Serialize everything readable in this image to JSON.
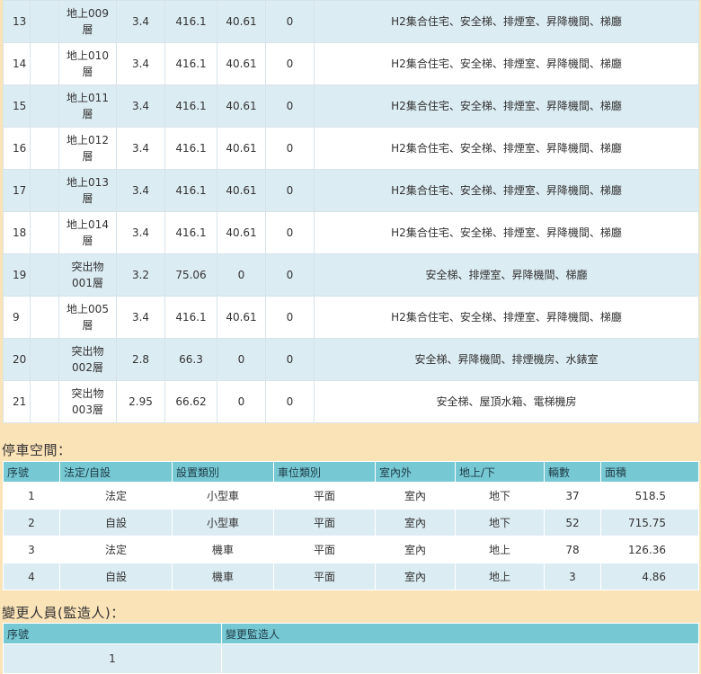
{
  "floors": [
    {
      "no": "13",
      "floor": "地上009\n層",
      "height": "3.4",
      "area": "416.1",
      "area2": "40.61",
      "extra": "0",
      "usage": "H2集合住宅、安全梯、排煙室、昇降機間、梯廳"
    },
    {
      "no": "14",
      "floor": "地上010\n層",
      "height": "3.4",
      "area": "416.1",
      "area2": "40.61",
      "extra": "0",
      "usage": "H2集合住宅、安全梯、排煙室、昇降機間、梯廳"
    },
    {
      "no": "15",
      "floor": "地上011\n層",
      "height": "3.4",
      "area": "416.1",
      "area2": "40.61",
      "extra": "0",
      "usage": "H2集合住宅、安全梯、排煙室、昇降機間、梯廳"
    },
    {
      "no": "16",
      "floor": "地上012\n層",
      "height": "3.4",
      "area": "416.1",
      "area2": "40.61",
      "extra": "0",
      "usage": "H2集合住宅、安全梯、排煙室、昇降機間、梯廳"
    },
    {
      "no": "17",
      "floor": "地上013\n層",
      "height": "3.4",
      "area": "416.1",
      "area2": "40.61",
      "extra": "0",
      "usage": "H2集合住宅、安全梯、排煙室、昇降機間、梯廳"
    },
    {
      "no": "18",
      "floor": "地上014\n層",
      "height": "3.4",
      "area": "416.1",
      "area2": "40.61",
      "extra": "0",
      "usage": "H2集合住宅、安全梯、排煙室、昇降機間、梯廳"
    },
    {
      "no": "19",
      "floor": "突出物\n001層",
      "height": "3.2",
      "area": "75.06",
      "area2": "0",
      "extra": "0",
      "usage": "安全梯、排煙室、昇降機間、梯廳"
    },
    {
      "no": "9",
      "floor": "地上005\n層",
      "height": "3.4",
      "area": "416.1",
      "area2": "40.61",
      "extra": "0",
      "usage": "H2集合住宅、安全梯、排煙室、昇降機間、梯廳"
    },
    {
      "no": "20",
      "floor": "突出物\n002層",
      "height": "2.8",
      "area": "66.3",
      "area2": "0",
      "extra": "0",
      "usage": "安全梯、昇降機間、排煙機房、水錶室"
    },
    {
      "no": "21",
      "floor": "突出物\n003層",
      "height": "2.95",
      "area": "66.62",
      "area2": "0",
      "extra": "0",
      "usage": "安全梯、屋頂水箱、電梯機房"
    }
  ],
  "parking": {
    "title": "停車空間：",
    "headers": [
      "序號",
      "法定/自設",
      "設置類別",
      "車位類別",
      "室內外",
      "地上/下",
      "輛數",
      "面積"
    ],
    "rows": [
      [
        "1",
        "法定",
        "小型車",
        "平面",
        "室內",
        "地下",
        "37",
        "518.5"
      ],
      [
        "2",
        "自設",
        "小型車",
        "平面",
        "室內",
        "地下",
        "52",
        "715.75"
      ],
      [
        "3",
        "法定",
        "機車",
        "平面",
        "室內",
        "地上",
        "78",
        "126.36"
      ],
      [
        "4",
        "自設",
        "機車",
        "平面",
        "室內",
        "地上",
        "3",
        "4.86"
      ]
    ]
  },
  "changer": {
    "title": "變更人員(監造人)：",
    "headers": [
      "序號",
      "變更監造人"
    ],
    "rows": [
      [
        "1",
        ""
      ]
    ]
  }
}
